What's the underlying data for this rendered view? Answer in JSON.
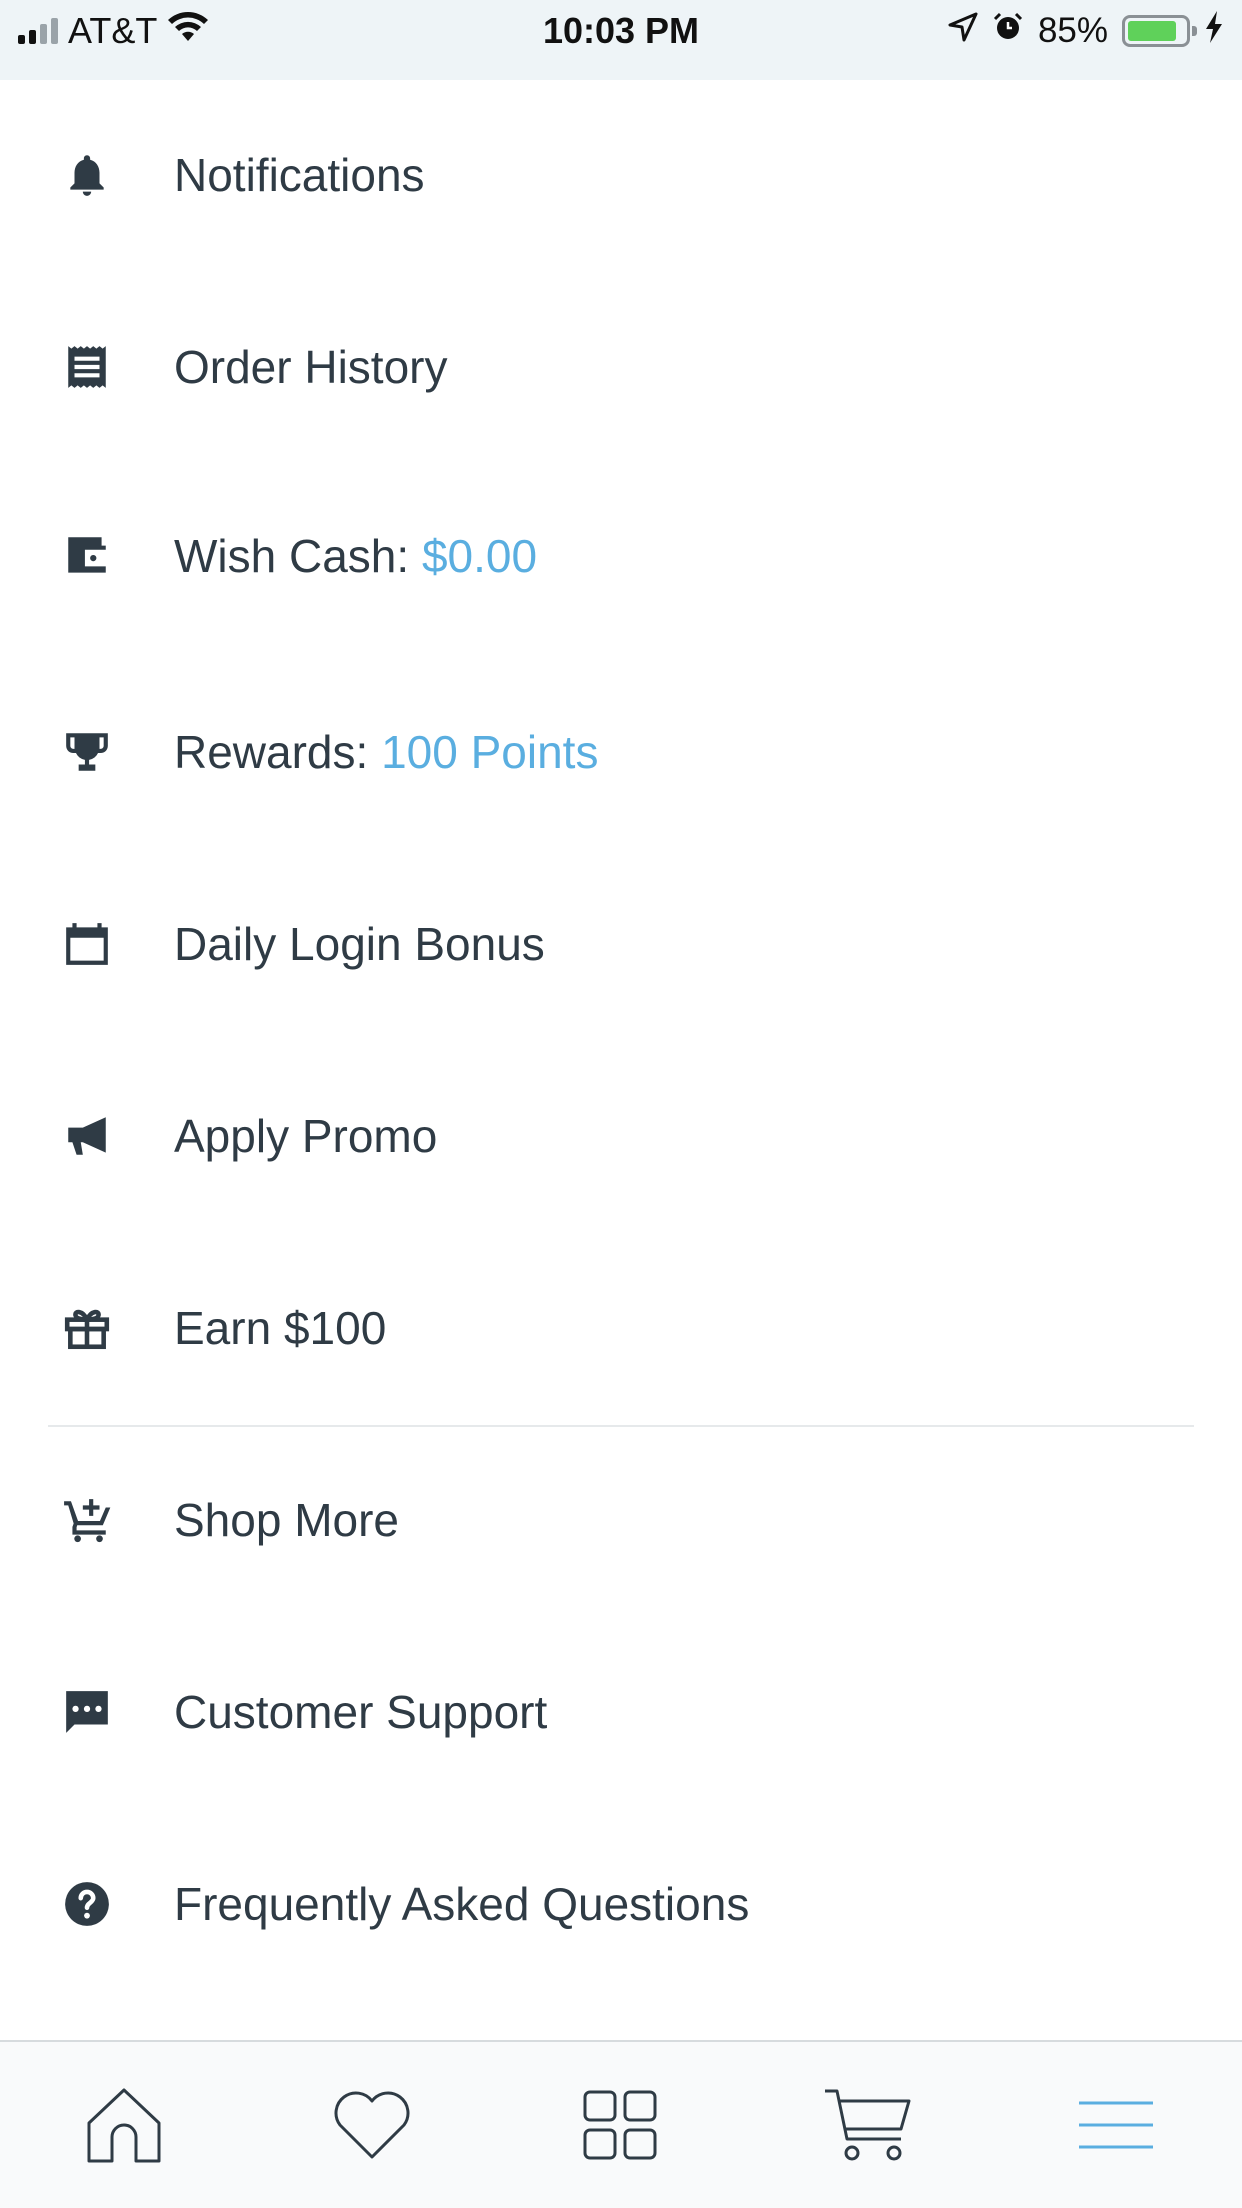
{
  "status_bar": {
    "carrier": "AT&T",
    "time": "10:03 PM",
    "battery_percent": "85%",
    "battery_level": 0.85,
    "icons": [
      "signal-icon",
      "wifi-icon",
      "location-icon",
      "alarm-icon",
      "battery-icon",
      "charging-icon"
    ]
  },
  "menu": {
    "items": [
      {
        "icon": "bell-icon",
        "label": "Notifications"
      },
      {
        "icon": "receipt-icon",
        "label": "Order History"
      },
      {
        "icon": "wallet-icon",
        "label": "Wish Cash: ",
        "value": "$0.00"
      },
      {
        "icon": "trophy-icon",
        "label": "Rewards: ",
        "value": "100 Points"
      },
      {
        "icon": "calendar-icon",
        "label": "Daily Login Bonus"
      },
      {
        "icon": "megaphone-icon",
        "label": "Apply Promo"
      },
      {
        "icon": "gift-icon",
        "label": "Earn $100"
      },
      {
        "icon": "cart-plus-icon",
        "label": "Shop More"
      },
      {
        "icon": "chat-icon",
        "label": "Customer Support"
      },
      {
        "icon": "question-icon",
        "label": "Frequently Asked Questions"
      }
    ]
  },
  "tab_bar": {
    "tabs": [
      {
        "icon": "home-icon",
        "active": false
      },
      {
        "icon": "heart-icon",
        "active": false
      },
      {
        "icon": "grid-icon",
        "active": false
      },
      {
        "icon": "cart-icon",
        "active": false
      },
      {
        "icon": "menu-icon",
        "active": true
      }
    ]
  },
  "colors": {
    "accent": "#5aaee0",
    "text": "#2f3b45",
    "status_bar_bg": "#eef4f7",
    "battery_green": "#5fd15a"
  }
}
